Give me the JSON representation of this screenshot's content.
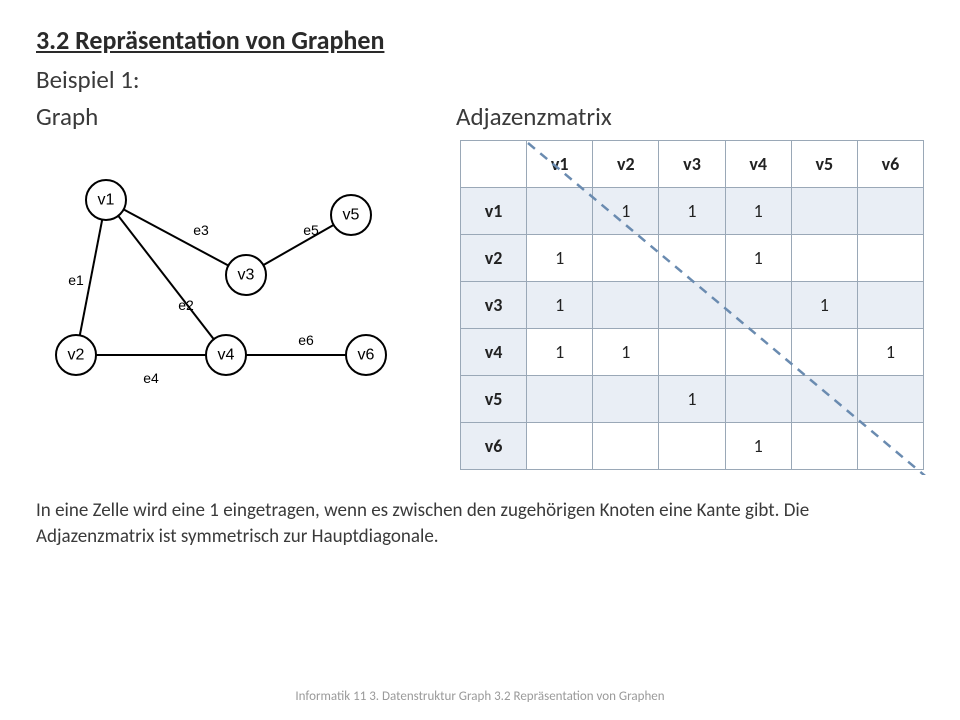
{
  "heading": "3.2 Repräsentation von Graphen",
  "subheading": "Beispiel 1:",
  "labels": {
    "graph": "Graph",
    "matrix": "Adjazenzmatrix"
  },
  "graph": {
    "nodes": [
      "v1",
      "v2",
      "v3",
      "v4",
      "v5",
      "v6"
    ],
    "edges": [
      "e1",
      "e2",
      "e3",
      "e4",
      "e5",
      "e6"
    ]
  },
  "matrix": {
    "headers": [
      "v1",
      "v2",
      "v3",
      "v4",
      "v5",
      "v6"
    ],
    "rows": [
      {
        "name": "v1",
        "cells": [
          "",
          "1",
          "1",
          "1",
          "",
          ""
        ]
      },
      {
        "name": "v2",
        "cells": [
          "1",
          "",
          "",
          "1",
          "",
          ""
        ]
      },
      {
        "name": "v3",
        "cells": [
          "1",
          "",
          "",
          "",
          "1",
          ""
        ]
      },
      {
        "name": "v4",
        "cells": [
          "1",
          "1",
          "",
          "",
          "",
          "1"
        ]
      },
      {
        "name": "v5",
        "cells": [
          "",
          "",
          "1",
          "",
          "",
          ""
        ]
      },
      {
        "name": "v6",
        "cells": [
          "",
          "",
          "",
          "1",
          "",
          ""
        ]
      }
    ]
  },
  "explain": "In eine Zelle wird eine 1 eingetragen, wenn es zwischen den zugehörigen Knoten eine Kante gibt. Die Adjazenzmatrix ist symmetrisch zur Hauptdiagonale.",
  "footer": "Informatik 11 3. Datenstruktur Graph 3.2 Repräsentation von Graphen",
  "chart_data": {
    "type": "table",
    "title": "Adjazenzmatrix",
    "categories": [
      "v1",
      "v2",
      "v3",
      "v4",
      "v5",
      "v6"
    ],
    "series": [
      {
        "name": "v1",
        "values": [
          0,
          1,
          1,
          1,
          0,
          0
        ]
      },
      {
        "name": "v2",
        "values": [
          1,
          0,
          0,
          1,
          0,
          0
        ]
      },
      {
        "name": "v3",
        "values": [
          1,
          0,
          0,
          0,
          1,
          0
        ]
      },
      {
        "name": "v4",
        "values": [
          1,
          1,
          0,
          0,
          0,
          1
        ]
      },
      {
        "name": "v5",
        "values": [
          0,
          0,
          1,
          0,
          0,
          0
        ]
      },
      {
        "name": "v6",
        "values": [
          0,
          0,
          0,
          1,
          0,
          0
        ]
      }
    ],
    "edges": [
      {
        "id": "e1",
        "from": "v1",
        "to": "v2"
      },
      {
        "id": "e2",
        "from": "v1",
        "to": "v4"
      },
      {
        "id": "e3",
        "from": "v1",
        "to": "v3"
      },
      {
        "id": "e4",
        "from": "v2",
        "to": "v4"
      },
      {
        "id": "e5",
        "from": "v3",
        "to": "v5"
      },
      {
        "id": "e6",
        "from": "v4",
        "to": "v6"
      }
    ]
  }
}
